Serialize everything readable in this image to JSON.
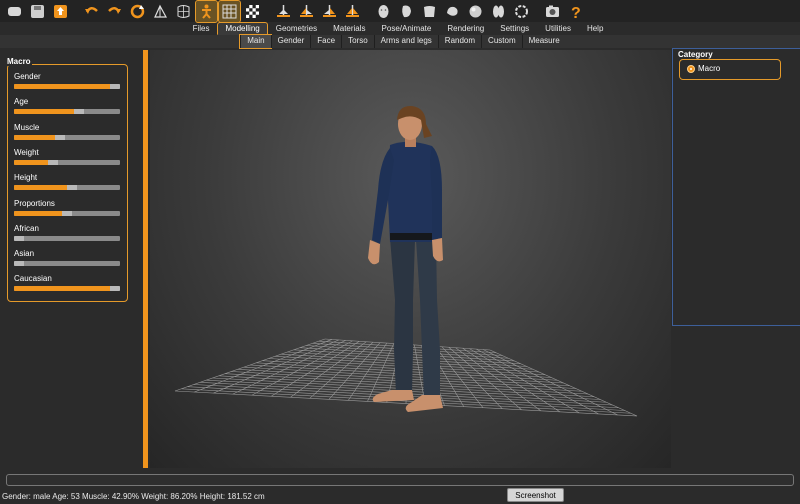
{
  "toolbar": {
    "icons": [
      "undo-icon",
      "redo-icon",
      "reset-icon",
      "symmetry-icon",
      "wireframe-icon",
      "smooth-icon",
      "background-icon",
      "front-view-icon",
      "back-view-icon",
      "left-view-icon",
      "right-view-icon",
      "top-view-icon",
      "bottom-view-icon",
      "reset-camera-icon",
      "screenshot-icon",
      "help-icon"
    ],
    "accent": "#e59a2a"
  },
  "tabs": [
    {
      "label": "Files"
    },
    {
      "label": "Modelling",
      "active": true
    },
    {
      "label": "Geometries"
    },
    {
      "label": "Materials"
    },
    {
      "label": "Pose/Animate"
    },
    {
      "label": "Rendering"
    },
    {
      "label": "Settings"
    },
    {
      "label": "Utilities"
    },
    {
      "label": "Help"
    }
  ],
  "subtabs": [
    {
      "label": "Main",
      "active": true
    },
    {
      "label": "Gender"
    },
    {
      "label": "Face"
    },
    {
      "label": "Torso"
    },
    {
      "label": "Arms and legs"
    },
    {
      "label": "Random"
    },
    {
      "label": "Custom"
    },
    {
      "label": "Measure"
    }
  ],
  "macro": {
    "title": "Macro",
    "sliders": [
      {
        "label": "Gender",
        "value": 1.0
      },
      {
        "label": "Age",
        "value": 0.62
      },
      {
        "label": "Muscle",
        "value": 0.43
      },
      {
        "label": "Weight",
        "value": 0.35
      },
      {
        "label": "Height",
        "value": 0.55
      },
      {
        "label": "Proportions",
        "value": 0.5
      },
      {
        "label": "African",
        "value": 0.0
      },
      {
        "label": "Asian",
        "value": 0.0
      },
      {
        "label": "Caucasian",
        "value": 1.0
      }
    ]
  },
  "category": {
    "title": "Category",
    "option": "Macro"
  },
  "status": {
    "text": "Gender: male Age: 53 Muscle: 42.90% Weight: 86.20% Height: 181.52 cm"
  },
  "screenshot_button": "Screenshot",
  "colors": {
    "accent": "#f0941d",
    "panel": "#2b2b2b",
    "highlight_border": "#3d5f9a"
  }
}
